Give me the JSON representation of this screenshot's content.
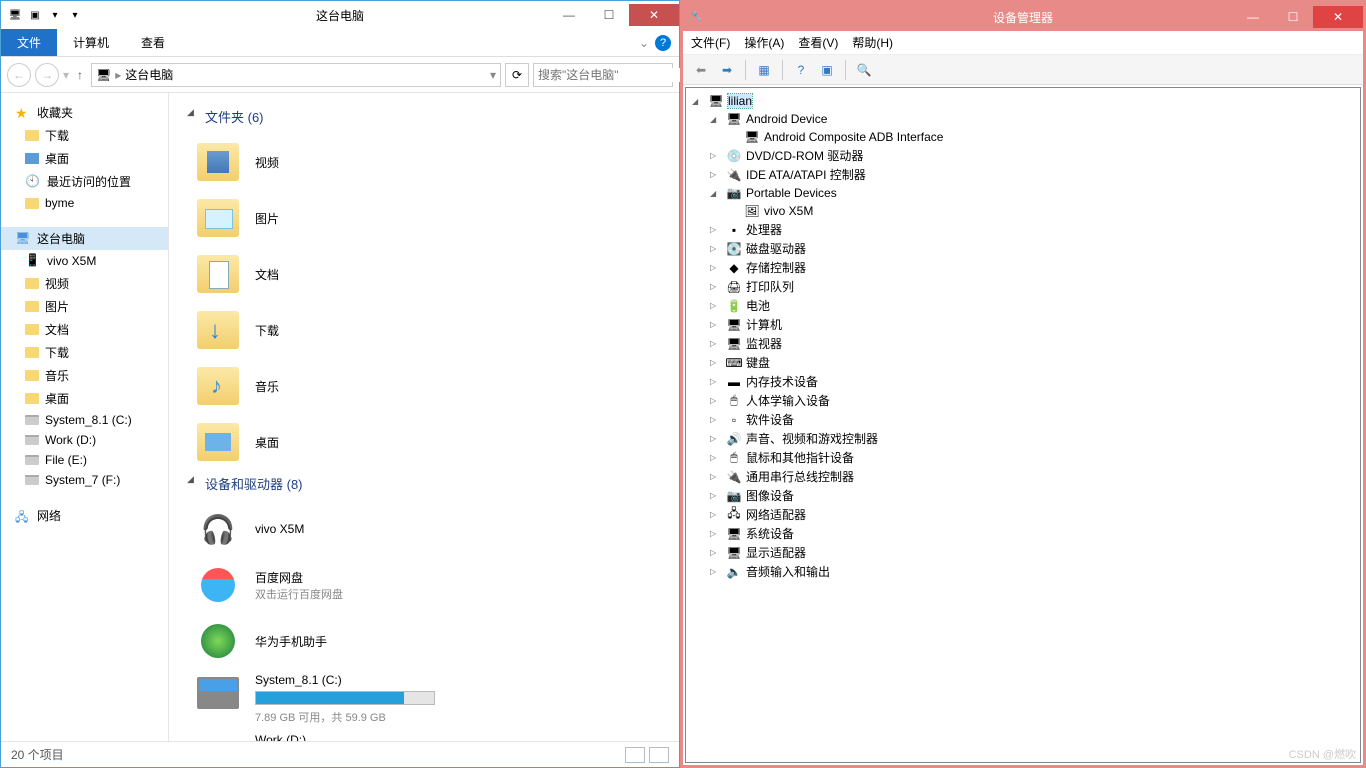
{
  "left": {
    "title": "这台电脑",
    "ribbon": {
      "file": "文件",
      "computer": "计算机",
      "view": "查看"
    },
    "breadcrumb": "这台电脑",
    "search_placeholder": "搜索\"这台电脑\"",
    "favorites": {
      "header": "收藏夹",
      "items": [
        "下载",
        "桌面",
        "最近访问的位置",
        "byme"
      ]
    },
    "thispc": {
      "header": "这台电脑",
      "items": [
        "vivo X5M",
        "视频",
        "图片",
        "文档",
        "下载",
        "音乐",
        "桌面",
        "System_8.1 (C:)",
        "Work (D:)",
        "File (E:)",
        "System_7 (F:)"
      ]
    },
    "network": "网络",
    "folders": {
      "header": "文件夹 (6)",
      "items": [
        "视频",
        "图片",
        "文档",
        "下载",
        "音乐",
        "桌面"
      ]
    },
    "devices": {
      "header": "设备和驱动器 (8)",
      "vivo": "vivo X5M",
      "baidu": {
        "name": "百度网盘",
        "sub": "双击运行百度网盘"
      },
      "huawei": "华为手机助手",
      "sysc": {
        "name": "System_8.1 (C:)",
        "sub": "7.89 GB 可用，共 59.9 GB"
      },
      "workd": "Work (D:)"
    },
    "status": "20 个项目"
  },
  "right": {
    "title": "设备管理器",
    "menus": {
      "file": "文件(F)",
      "action": "操作(A)",
      "view": "查看(V)",
      "help": "帮助(H)"
    },
    "root": "lilian",
    "nodes": {
      "android": "Android Device",
      "android_sub": "Android Composite ADB Interface",
      "dvd": "DVD/CD-ROM 驱动器",
      "ide": "IDE ATA/ATAPI 控制器",
      "portable": "Portable Devices",
      "portable_sub": "vivo X5M",
      "cpu": "处理器",
      "disk": "磁盘驱动器",
      "storage": "存储控制器",
      "print": "打印队列",
      "battery": "电池",
      "computer": "计算机",
      "monitor": "监视器",
      "keyboard": "键盘",
      "memory": "内存技术设备",
      "hid": "人体学输入设备",
      "software": "软件设备",
      "audio": "声音、视频和游戏控制器",
      "mouse": "鼠标和其他指针设备",
      "usb": "通用串行总线控制器",
      "image": "图像设备",
      "net": "网络适配器",
      "system": "系统设备",
      "display": "显示适配器",
      "audioio": "音频输入和输出"
    }
  },
  "watermark": "CSDN @燃吹"
}
